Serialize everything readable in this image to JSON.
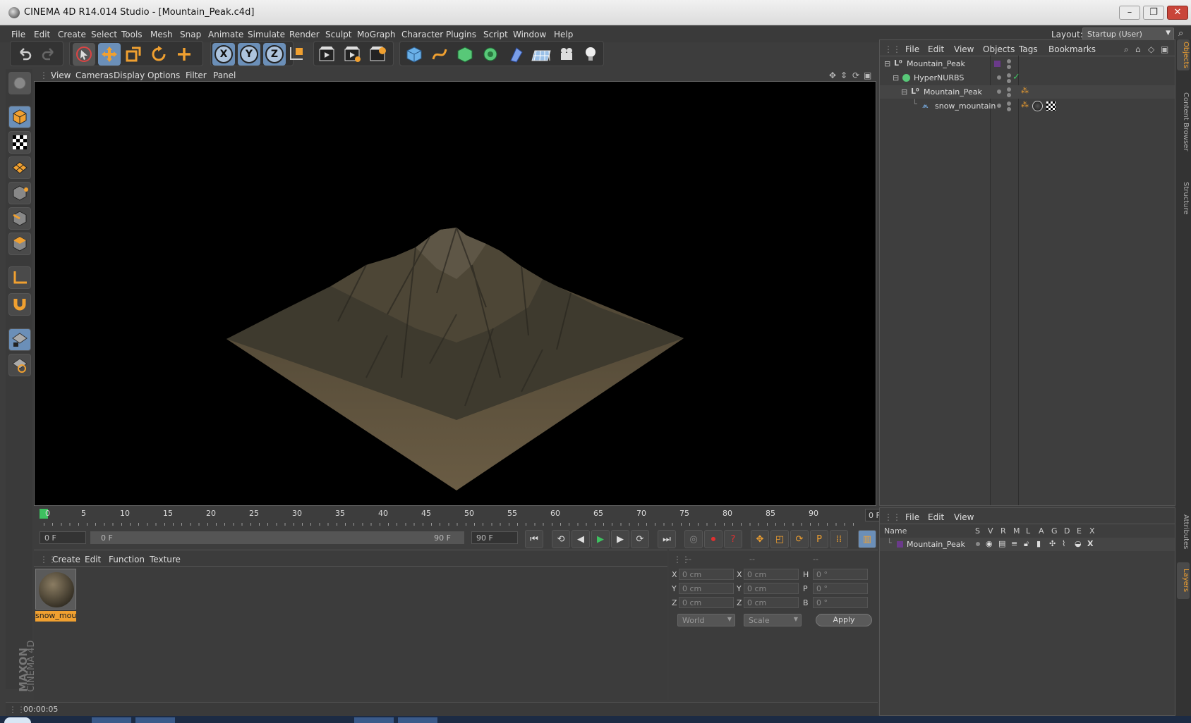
{
  "window": {
    "title": "CINEMA 4D R14.014 Studio - [Mountain_Peak.c4d]"
  },
  "menu": [
    "File",
    "Edit",
    "Create",
    "Select",
    "Tools",
    "Mesh",
    "Snap",
    "Animate",
    "Simulate",
    "Render",
    "Sculpt",
    "MoGraph",
    "Character",
    "Plugins",
    "Script",
    "Window",
    "Help"
  ],
  "layout": {
    "label": "Layout:",
    "value": "Startup (User)"
  },
  "toolbar": {
    "icons": [
      "undo-icon",
      "redo-icon",
      "live-selection-icon",
      "move-icon",
      "scale-icon",
      "rotate-icon",
      "add-icon",
      "x-axis-icon",
      "y-axis-icon",
      "z-axis-icon",
      "coordinate-system-icon",
      "render-view-icon",
      "render-picture-viewer-icon",
      "render-settings-icon",
      "cube-icon",
      "spline-icon",
      "nurbs-icon",
      "array-icon",
      "deformer-icon",
      "environment-icon",
      "camera-icon",
      "light-icon"
    ],
    "axis_labels": [
      "X",
      "Y",
      "Z"
    ]
  },
  "viewport": {
    "menu": [
      "View",
      "Cameras",
      "Display",
      "Options",
      "Filter",
      "Panel"
    ]
  },
  "timeline": {
    "ticks": [
      "0",
      "5",
      "10",
      "15",
      "20",
      "25",
      "30",
      "35",
      "40",
      "45",
      "50",
      "55",
      "60",
      "65",
      "70",
      "75",
      "80",
      "85",
      "90"
    ],
    "current_frame_field": "0 F",
    "start_field": "0 F",
    "range_start": "0 F",
    "range_end": "90 F",
    "end_field": "90 F",
    "frame_end": "0 F"
  },
  "material_panel": {
    "menu": [
      "Create",
      "Edit",
      "Function",
      "Texture"
    ],
    "materials": [
      {
        "name": "snow_mou"
      }
    ]
  },
  "coord_panel": {
    "headers": [
      "--",
      "--",
      "--"
    ],
    "rows": [
      {
        "a": "X",
        "av": "0 cm",
        "b": "X",
        "bv": "0 cm",
        "c": "H",
        "cv": "0 °"
      },
      {
        "a": "Y",
        "av": "0 cm",
        "b": "Y",
        "bv": "0 cm",
        "c": "P",
        "cv": "0 °"
      },
      {
        "a": "Z",
        "av": "0 cm",
        "b": "Z",
        "bv": "0 cm",
        "c": "B",
        "cv": "0 °"
      }
    ],
    "space_select": "World",
    "mode_select": "Scale",
    "apply_label": "Apply"
  },
  "object_manager": {
    "menu": [
      "File",
      "Edit",
      "View",
      "Objects",
      "Tags",
      "Bookmarks"
    ],
    "objects": [
      {
        "name": "Mountain_Peak",
        "indent": 0
      },
      {
        "name": "HyperNURBS",
        "indent": 1
      },
      {
        "name": "Mountain_Peak",
        "indent": 2
      },
      {
        "name": "snow_mountain",
        "indent": 3
      }
    ]
  },
  "layer_manager": {
    "menu": [
      "File",
      "Edit",
      "View"
    ],
    "columns": [
      "Name",
      "S",
      "V",
      "R",
      "M",
      "L",
      "A",
      "G",
      "D",
      "E",
      "X"
    ],
    "layers": [
      {
        "name": "Mountain_Peak"
      }
    ]
  },
  "right_tabs": [
    "Objects",
    "Content Browser",
    "Structure",
    "Attributes",
    "Layers"
  ],
  "status": {
    "time": "00:00:05"
  },
  "brand": {
    "line1": "MAXON",
    "line2": "CINEMA 4D"
  },
  "colors": {
    "accent": "#f0a030",
    "active_blue": "#6b8fb8",
    "viewport_bg": "#000000"
  }
}
